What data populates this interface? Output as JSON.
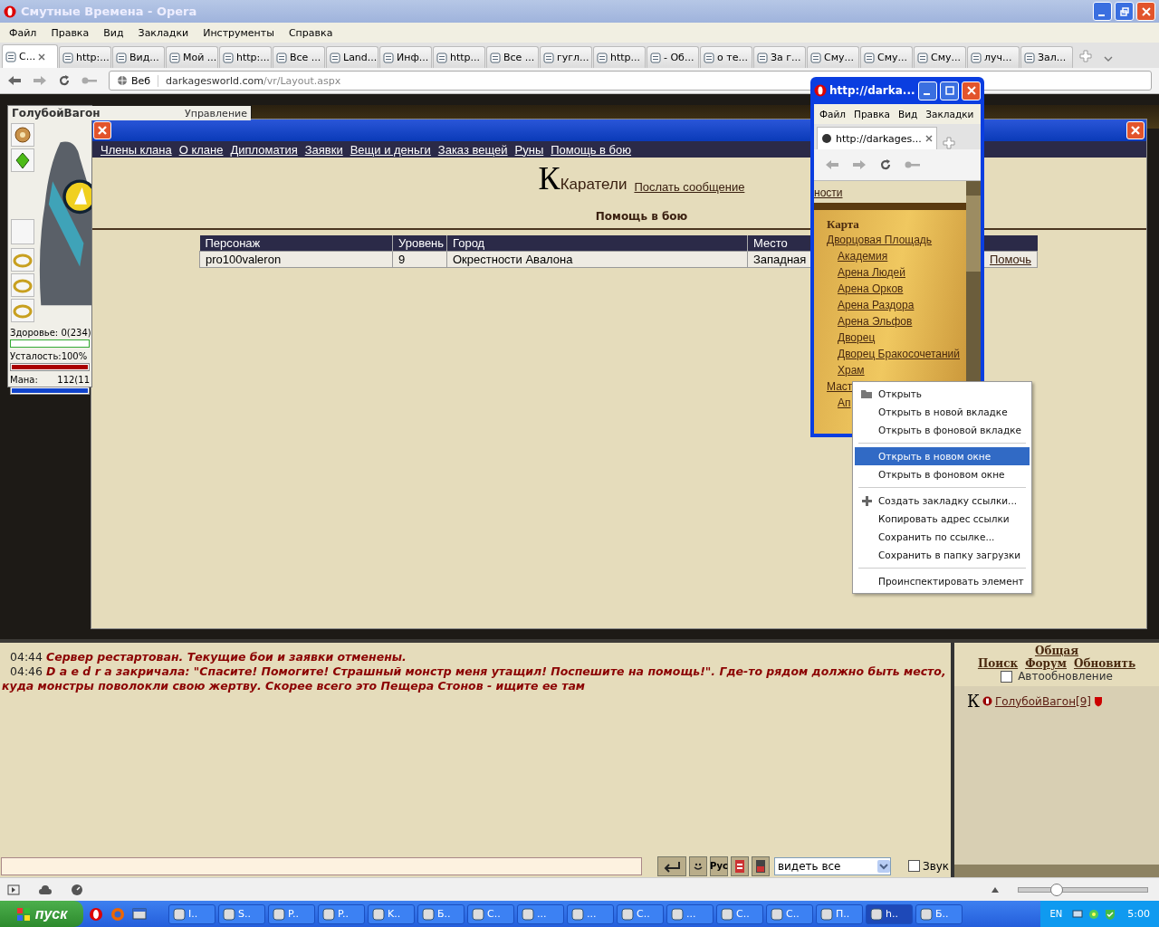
{
  "window": {
    "title": "Смутные Времена - Opera"
  },
  "menu": [
    "Файл",
    "Правка",
    "Вид",
    "Закладки",
    "Инструменты",
    "Справка"
  ],
  "tabs": [
    {
      "label": "С...",
      "selected": true
    },
    {
      "label": "http:...",
      "selected": false
    },
    {
      "label": "Вид...",
      "selected": false
    },
    {
      "label": "Мой ...",
      "selected": false
    },
    {
      "label": "http:...",
      "selected": false
    },
    {
      "label": "Все ...",
      "selected": false
    },
    {
      "label": "Land...",
      "selected": false
    },
    {
      "label": "Инф...",
      "selected": false
    },
    {
      "label": "http...",
      "selected": false
    },
    {
      "label": "Все ...",
      "selected": false
    },
    {
      "label": "гугл...",
      "selected": false
    },
    {
      "label": "http...",
      "selected": false
    },
    {
      "label": "- Об...",
      "selected": false
    },
    {
      "label": "о те...",
      "selected": false
    },
    {
      "label": "За г...",
      "selected": false
    },
    {
      "label": "Сму...",
      "selected": false
    },
    {
      "label": "Сму...",
      "selected": false
    },
    {
      "label": "Сму...",
      "selected": false
    },
    {
      "label": "луч...",
      "selected": false
    },
    {
      "label": "Зал...",
      "selected": false
    }
  ],
  "address": {
    "badge": "Веб",
    "host": "darkagesworld.com",
    "path": "/vr/Layout.aspx"
  },
  "game_header": {
    "control": "Управление"
  },
  "character": {
    "name": "ГолубойВагон",
    "health": {
      "text": "Здоровье:  0(234)",
      "level": 0
    },
    "fatigue": {
      "text": "Усталость:100%",
      "level": 1
    },
    "mana": {
      "label": "Мана:",
      "text": "112(11",
      "level": 1
    }
  },
  "clan_dialog": {
    "nav": [
      "Члены клана",
      "О клане",
      "Дипломатия",
      "Заявки",
      "Вещи и деньги",
      "Заказ вещей",
      "Руны",
      "Помощь в бою"
    ],
    "emblem": "К",
    "clan_name": "Каратели",
    "send_message": "Послать сообщение",
    "section": "Помощь в бою",
    "table": {
      "columns": [
        "Персонаж",
        "Уровень",
        "Город",
        "Место"
      ],
      "rows": [
        {
          "cells": [
            "pro100valeron",
            "9",
            "Окрестности Авалона",
            "Западная"
          ],
          "action": "Помочь"
        }
      ]
    }
  },
  "popup": {
    "title": "http://darka...",
    "menu": [
      "Файл",
      "Правка",
      "Вид",
      "Закладки"
    ],
    "tab": "http://darkages...",
    "link": "ности",
    "map_title": "Карта",
    "tree": [
      {
        "label": "Дворцовая Площадь",
        "children": [
          {
            "label": "Академия"
          },
          {
            "label": "Арена Людей"
          },
          {
            "label": "Арена Орков"
          },
          {
            "label": "Арена Раздора"
          },
          {
            "label": "Арена Эльфов"
          },
          {
            "label": "Дворец"
          },
          {
            "label": "Дворец Бракосочетаний"
          },
          {
            "label": "Храм"
          }
        ]
      },
      {
        "label": "Маст",
        "children": [
          {
            "label": "Ап"
          }
        ]
      }
    ]
  },
  "context_menu": [
    {
      "kind": "folder",
      "label": "Открыть",
      "selected": false
    },
    {
      "kind": "item",
      "label": "Открыть в новой вкладке",
      "selected": false
    },
    {
      "kind": "item",
      "label": "Открыть в фоновой вкладке",
      "selected": false
    },
    {
      "kind": "separator"
    },
    {
      "kind": "item",
      "label": "Открыть в новом окне",
      "selected": true
    },
    {
      "kind": "item",
      "label": "Открыть в фоновом окне",
      "selected": false
    },
    {
      "kind": "separator"
    },
    {
      "kind": "plus",
      "label": "Создать закладку ссылки...",
      "selected": false
    },
    {
      "kind": "item",
      "label": "Копировать адрес ссылки",
      "selected": false
    },
    {
      "kind": "item",
      "label": "Сохранить по ссылке...",
      "selected": false
    },
    {
      "kind": "item",
      "label": "Сохранить в папку загрузки",
      "selected": false
    },
    {
      "kind": "separator"
    },
    {
      "kind": "item",
      "label": "Проинспектировать элемент",
      "selected": false
    }
  ],
  "chat": [
    {
      "time": "04:44",
      "text": "Сервер рестартован. Текущие бои и заявки отменены."
    },
    {
      "time": "04:46",
      "text": "D a e d r a закричала: \"Спасите! Помогите! Страшный монстр меня утащил! Поспешите на помощь!\". Где-то рядом должно быть место, куда монстры поволокли свою жертву. Скорее всего это Пещера Стонов - ищите ее там"
    }
  ],
  "chat_panel": {
    "channel": "Общая",
    "links": [
      "Поиск",
      "Форум",
      "Обновить"
    ],
    "auto_update": {
      "label": "Автообновление",
      "checked": false
    },
    "users": [
      {
        "emblem": "К",
        "name": "ГолубойВагон[9]"
      }
    ]
  },
  "chat_input": {
    "lang_button": "Рус",
    "filter": "видеть все",
    "sound": {
      "label": "Звук",
      "checked": false
    }
  },
  "status_bar": {
    "zoom": {
      "level": 0.29
    }
  },
  "taskbar": {
    "start": "пуск",
    "tasks": [
      {
        "label": "I..",
        "selected": false
      },
      {
        "label": "S..",
        "selected": false
      },
      {
        "label": "P..",
        "selected": false
      },
      {
        "label": "P..",
        "selected": false
      },
      {
        "label": "K..",
        "selected": false
      },
      {
        "label": "Б..",
        "selected": false
      },
      {
        "label": "С..",
        "selected": false
      },
      {
        "label": "...",
        "selected": false
      },
      {
        "label": "...",
        "selected": false
      },
      {
        "label": "С..",
        "selected": false
      },
      {
        "label": "...",
        "selected": false
      },
      {
        "label": "С..",
        "selected": false
      },
      {
        "label": "С..",
        "selected": false
      },
      {
        "label": "П..",
        "selected": false
      },
      {
        "label": "h..",
        "selected": true
      },
      {
        "label": "Б..",
        "selected": false
      }
    ],
    "lang": "EN",
    "clock": "5:00"
  }
}
